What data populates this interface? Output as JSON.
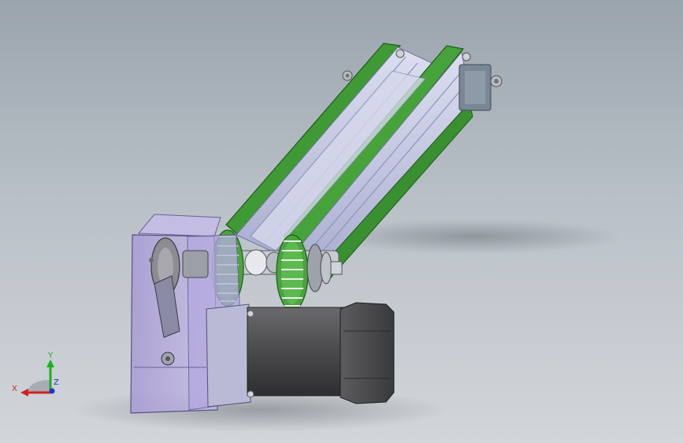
{
  "viewport": {
    "background_top": "#9aa4ae",
    "background_bottom": "#d2d6da"
  },
  "triad": {
    "x_label": "X",
    "y_label": "Y",
    "z_label": "Z",
    "x_color": "#d42020",
    "y_color": "#19b01c",
    "z_color": "#2233cc"
  },
  "model": {
    "parts": [
      {
        "name": "housing",
        "color": "#b4a8dc"
      },
      {
        "name": "belt",
        "color": "#3f9a35"
      },
      {
        "name": "rail",
        "color": "#c3c6e4"
      },
      {
        "name": "motor",
        "color": "#4a4a4c"
      },
      {
        "name": "pulley",
        "color": "#4aa43e"
      },
      {
        "name": "end-block",
        "color": "#7a8794"
      }
    ]
  }
}
